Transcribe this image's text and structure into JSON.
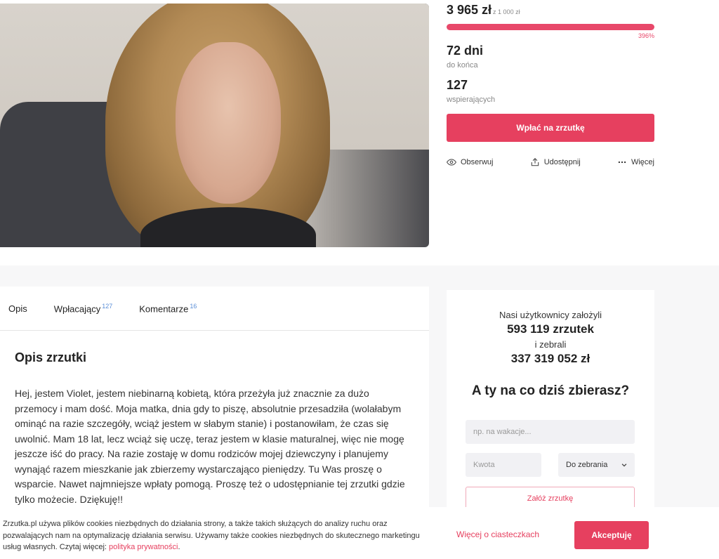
{
  "campaign": {
    "raised": "3 965 zł",
    "goal": "z 1 000 zł",
    "progress_percent": "396%",
    "progress_fraction": 1.0,
    "days_value": "72 dni",
    "days_label": "do końca",
    "supporters_value": "127",
    "supporters_label": "wspierających",
    "donate_label": "Wpłać na zrzutkę",
    "actions": {
      "follow": "Obserwuj",
      "share": "Udostępnij",
      "more": "Więcej"
    }
  },
  "tabs": [
    {
      "label": "Opis",
      "count": ""
    },
    {
      "label": "Wpłacający",
      "count": "127"
    },
    {
      "label": "Komentarze",
      "count": "16"
    }
  ],
  "description": {
    "title": "Opis zrzutki",
    "text": "Hej, jestem Violet, jestem niebinarną kobietą, która przeżyła już znacznie za dużo przemocy i mam dość. Moja matka, dnia gdy to piszę, absolutnie przesadziła (wolałabym ominąć na razie szczegóły, wciąż jestem w słabym stanie) i postanowiłam, że czas się uwolnić. Mam 18 lat, lecz wciąż się uczę, teraz jestem w klasie maturalnej, więc nie mogę jeszcze iść do pracy. Na razie zostaję w domu rodziców mojej dziewczyny i planujemy wynająć razem mieszkanie jak zbierzemy wystarczająco pieniędzy. Tu Was proszę o wsparcie. Nawet najmniejsze wpłaty pomogą. Proszę też o udostępnianie tej zrzutki gdzie tylko możecie. Dziękuję!!"
  },
  "side": {
    "line1": "Nasi użytkownicy założyli",
    "count": "593 119 zrzutek",
    "line2": "i zebrali",
    "total": "337 319 052 zł",
    "heading": "A ty na co dziś zbierasz?",
    "purpose_placeholder": "np. na wakacje...",
    "amount_placeholder": "Kwota",
    "select_value": "Do zebrania",
    "create_label": "Załóż zrzutkę"
  },
  "cookie": {
    "text": "Zrzutka.pl używa plików cookies niezbędnych do działania strony, a także takich służących do analizy ruchu oraz pozwalających nam na optymalizację działania serwisu. Używamy także cookies niezbędnych do skutecznego marketingu usług własnych. Czytaj więcej: ",
    "link": "polityka prywatności",
    "end": ".",
    "more_label": "Więcej o ciasteczkach",
    "accept_label": "Akceptuję"
  },
  "colors": {
    "accent": "#e6405f",
    "bar_bg": "#f3b8c3"
  }
}
